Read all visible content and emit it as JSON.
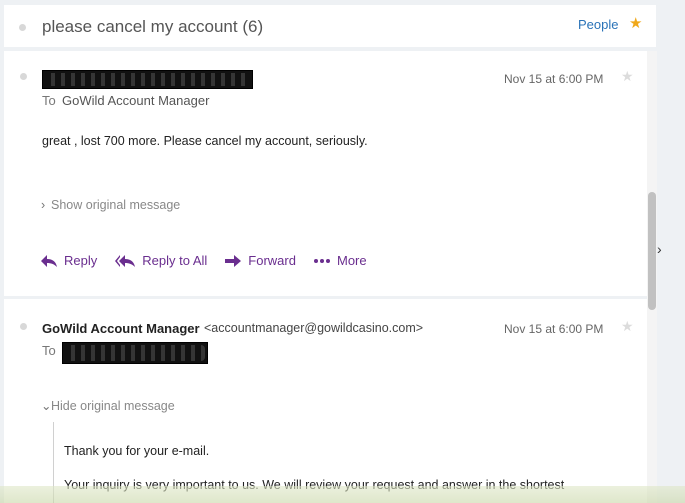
{
  "thread": {
    "subject": "please cancel my account (6)",
    "people_label": "People"
  },
  "messages": [
    {
      "to_label": "To",
      "to_value": "GoWild Account Manager",
      "date": "Nov 15 at 6:00 PM",
      "body": "great , lost 700 more. Please cancel my account, seriously.",
      "toggle_label": "Show original message",
      "actions": [
        "Reply",
        "Reply to All",
        "Forward",
        "More"
      ]
    },
    {
      "sender_name": "GoWild Account Manager",
      "sender_email": "<accountmanager@gowildcasino.com>",
      "to_label": "To",
      "date": "Nov 15 at 6:00 PM",
      "toggle_label": "Hide original message",
      "quote_lines": [
        "Thank you for your e-mail.",
        "Your inquiry is very important to us. We will review your request and answer in the shortest"
      ]
    }
  ],
  "colors": {
    "accent": "#6a2e8f",
    "link": "#2a73b8",
    "star": "#f0a81a"
  }
}
